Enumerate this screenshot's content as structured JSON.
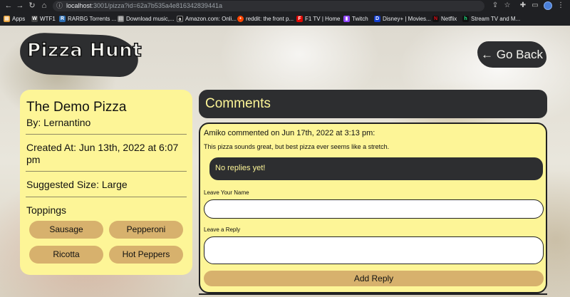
{
  "browser": {
    "url_host": "localhost",
    "url_rest": ":3001/pizza?id=62a7b535a4e816342839441a",
    "bookmarks": [
      {
        "label": "Apps",
        "icon": "apps-grid-icon",
        "color": "#e8eaed"
      },
      {
        "label": "WTF1",
        "icon": "wtf1-icon",
        "color": "#333333"
      },
      {
        "label": "RARBG Torrents ...",
        "icon": "rarbg-icon",
        "color": "#2b6cb0"
      },
      {
        "label": "Download music,...",
        "icon": "music-icon",
        "color": "#777777"
      },
      {
        "label": "Amazon.com: Onli...",
        "icon": "amazon-icon",
        "color": "#111111"
      },
      {
        "label": "reddit: the front p...",
        "icon": "reddit-icon",
        "color": "#ff4500"
      },
      {
        "label": "F1 TV | Home",
        "icon": "f1-icon",
        "color": "#e10600"
      },
      {
        "label": "Twitch",
        "icon": "twitch-icon",
        "color": "#9146ff"
      },
      {
        "label": "Disney+ | Movies...",
        "icon": "disney-icon",
        "color": "#113ccf"
      },
      {
        "label": "Netflix",
        "icon": "netflix-icon",
        "color": "#e50914"
      },
      {
        "label": "Stream TV and M...",
        "icon": "hulu-icon",
        "color": "#1ce783"
      }
    ]
  },
  "header": {
    "logo": "Pizza Hunt",
    "back_button": "← Go Back"
  },
  "pizza": {
    "name": "The Demo Pizza",
    "by": "By: Lernantino",
    "created": "Created At: Jun 13th, 2022 at 6:07 pm",
    "size": "Suggested Size: Large",
    "toppings_label": "Toppings",
    "toppings": [
      "Sausage",
      "Pepperoni",
      "Ricotta",
      "Hot Peppers"
    ]
  },
  "comments": {
    "title": "Comments",
    "items": [
      {
        "header": "Amiko commented on Jun 17th, 2022 at 3:13 pm:",
        "body": "This pizza sounds great, but best pizza ever seems like a stretch.",
        "no_replies": "No replies yet!",
        "name_label": "Leave Your Name",
        "reply_label": "Leave a Reply",
        "submit": "Add Reply"
      }
    ]
  },
  "colors": {
    "card_yellow": "#fdf597",
    "dark": "#2d2e30",
    "tan": "#d7b16d"
  }
}
